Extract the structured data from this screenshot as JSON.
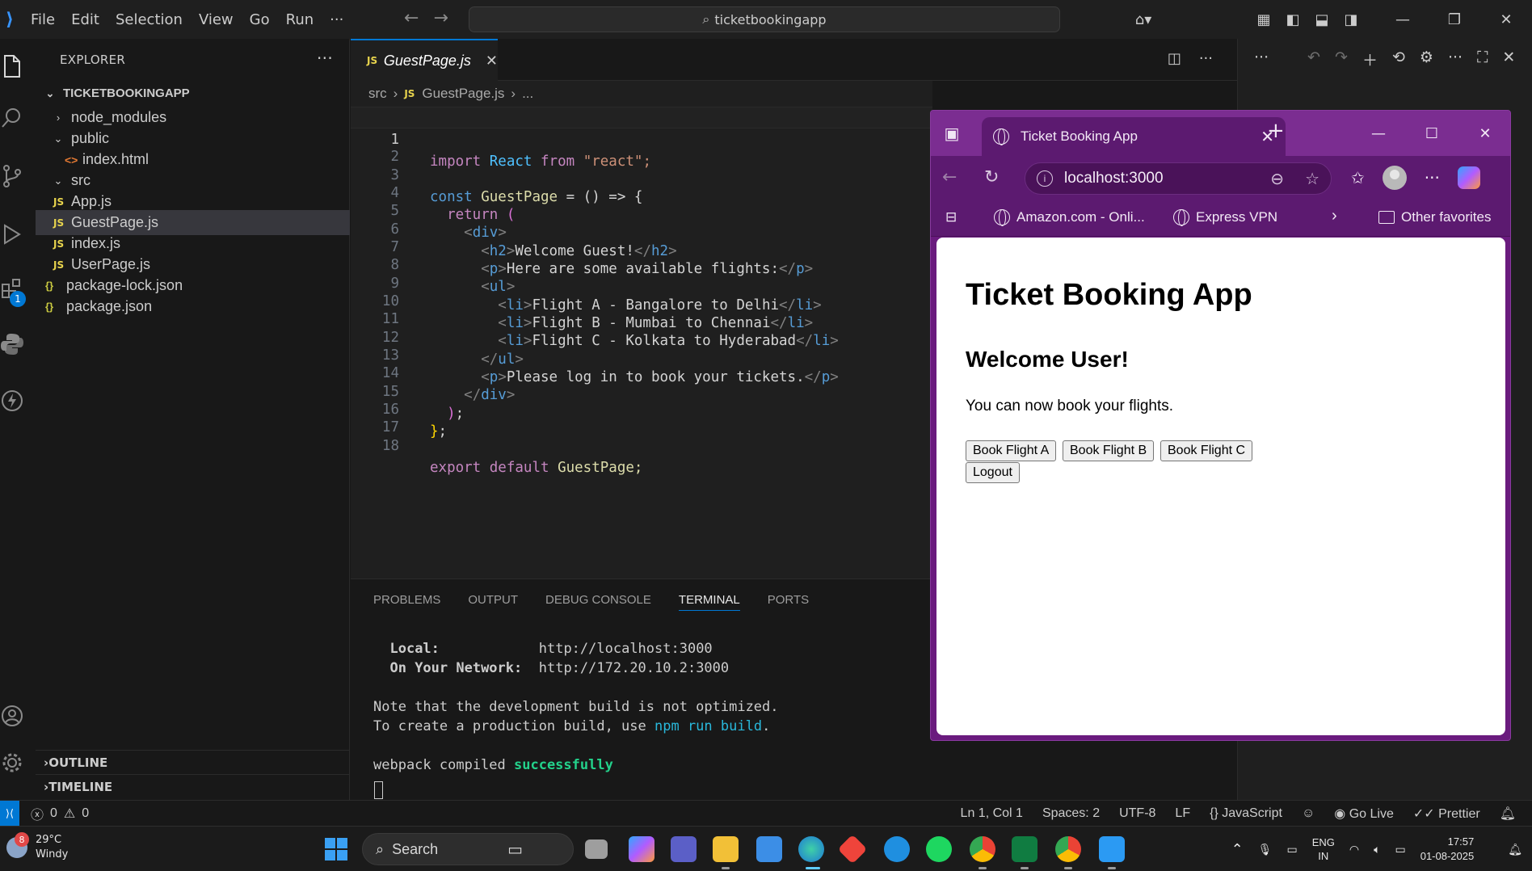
{
  "titlebar": {
    "menu": [
      "File",
      "Edit",
      "Selection",
      "View",
      "Go",
      "Run",
      "···"
    ],
    "search": "ticketbookingapp"
  },
  "activity": {
    "extensions_badge": "1"
  },
  "explorer": {
    "header": "EXPLORER",
    "root": "TICKETBOOKINGAPP",
    "items": [
      "node_modules",
      "public",
      "index.html",
      "src",
      "App.js",
      "GuestPage.js",
      "index.js",
      "UserPage.js",
      "package-lock.json",
      "package.json"
    ],
    "outline": "OUTLINE",
    "timeline": "TIMELINE"
  },
  "editor": {
    "tab": "GuestPage.js",
    "breadcrumb_src": "src",
    "breadcrumb_file": "GuestPage.js",
    "breadcrumb_more": "...",
    "line_numbers": [
      "1",
      "2",
      "3",
      "4",
      "5",
      "6",
      "7",
      "8",
      "9",
      "10",
      "11",
      "12",
      "13",
      "14",
      "15",
      "16",
      "17",
      "18"
    ],
    "code": {
      "l1_import": "import",
      "l1_react": "React",
      "l1_from": "from",
      "l1_str": "\"react\";",
      "l3_const": "const",
      "l3_name": "GuestPage",
      "l3_rest": " = () => {",
      "l4_return": "return",
      "l6_text": "Welcome Guest!",
      "l7_text": "Here are some available flights:",
      "l9_text": "Flight A - Bangalore to Delhi",
      "l10_text": "Flight B - Mumbai to Chennai",
      "l11_text": "Flight C - Kolkata to Hyderabad",
      "l13_text": "Please log in to book your tickets.",
      "l18_export": "export",
      "l18_default": "default",
      "l18_name": "GuestPage;"
    }
  },
  "panel": {
    "tabs": [
      "PROBLEMS",
      "OUTPUT",
      "DEBUG CONSOLE",
      "TERMINAL",
      "PORTS"
    ],
    "local_label": "Local:",
    "local_url": "http://localhost:3000",
    "network_label": "On Your Network:",
    "network_url": "http://172.20.10.2:3000",
    "note1": "Note that the development build is not optimized.",
    "note2_pre": "To create a production build, use ",
    "note2_cmd": "npm run build",
    "note2_post": ".",
    "compiled_pre": "webpack compiled ",
    "compiled_ok": "successfully"
  },
  "statusbar": {
    "errors": "0",
    "warnings": "0",
    "position": "Ln 1, Col 1",
    "spaces": "Spaces: 2",
    "encoding": "UTF-8",
    "eol": "LF",
    "language": "JavaScript",
    "golive": "Go Live",
    "prettier": "Prettier"
  },
  "browser": {
    "tab_title": "Ticket Booking App",
    "url": "localhost:3000",
    "fav1": "Amazon.com - Onli...",
    "fav2": "Express VPN",
    "fav_other": "Other favorites",
    "page": {
      "h1": "Ticket Booking App",
      "h2": "Welcome User!",
      "p": "You can now book your flights.",
      "btn_a": "Book Flight A",
      "btn_b": "Book Flight B",
      "btn_c": "Book Flight C",
      "btn_logout": "Logout"
    }
  },
  "taskbar": {
    "weather_badge": "8",
    "temp": "29°C",
    "condition": "Windy",
    "search": "Search",
    "lang1": "ENG",
    "lang2": "IN",
    "time": "17:57",
    "date": "01-08-2025"
  }
}
